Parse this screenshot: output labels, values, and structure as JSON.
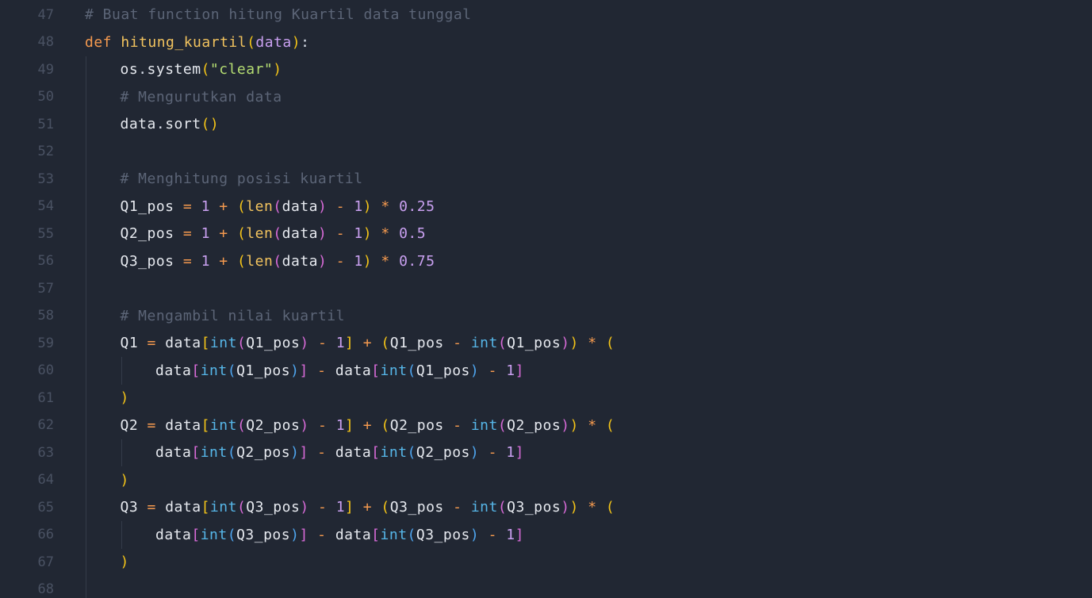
{
  "editor": {
    "language": "python",
    "theme": {
      "background": "#212733",
      "line_number": "#4a5263",
      "comment": "#5c6577",
      "keyword": "#f59a4f",
      "function": "#f2c35e",
      "string": "#b5dd72",
      "number": "#c9a0f0",
      "builtin": "#56b6e8",
      "bracket_level_1": "#f5c518",
      "bracket_level_2": "#d86bd8",
      "bracket_level_3": "#4fa6f0"
    },
    "lines": [
      {
        "num": "47",
        "indent": 0,
        "tokens": [
          [
            "cmt",
            "# Buat function hitung Kuartil data tunggal"
          ]
        ]
      },
      {
        "num": "48",
        "indent": 0,
        "tokens": [
          [
            "kw",
            "def"
          ],
          [
            "pln",
            " "
          ],
          [
            "fn",
            "hitung_kuartil"
          ],
          [
            "b1",
            "("
          ],
          [
            "par",
            "data"
          ],
          [
            "b1",
            ")"
          ],
          [
            "pln",
            ":"
          ]
        ]
      },
      {
        "num": "49",
        "indent": 1,
        "tokens": [
          [
            "var",
            "os"
          ],
          [
            "pln",
            "."
          ],
          [
            "var",
            "system"
          ],
          [
            "b1",
            "("
          ],
          [
            "str",
            "\"clear\""
          ],
          [
            "b1",
            ")"
          ]
        ]
      },
      {
        "num": "50",
        "indent": 1,
        "tokens": [
          [
            "cmt",
            "# Mengurutkan data"
          ]
        ]
      },
      {
        "num": "51",
        "indent": 1,
        "tokens": [
          [
            "var",
            "data"
          ],
          [
            "pln",
            "."
          ],
          [
            "var",
            "sort"
          ],
          [
            "b1",
            "()"
          ]
        ]
      },
      {
        "num": "52",
        "indent": 1,
        "tokens": []
      },
      {
        "num": "53",
        "indent": 1,
        "tokens": [
          [
            "cmt",
            "# Menghitung posisi kuartil"
          ]
        ]
      },
      {
        "num": "54",
        "indent": 1,
        "tokens": [
          [
            "var",
            "Q1_pos"
          ],
          [
            "pln",
            " "
          ],
          [
            "op",
            "="
          ],
          [
            "pln",
            " "
          ],
          [
            "num",
            "1"
          ],
          [
            "pln",
            " "
          ],
          [
            "op",
            "+"
          ],
          [
            "pln",
            " "
          ],
          [
            "b1",
            "("
          ],
          [
            "fn",
            "len"
          ],
          [
            "b2",
            "("
          ],
          [
            "var",
            "data"
          ],
          [
            "b2",
            ")"
          ],
          [
            "pln",
            " "
          ],
          [
            "op",
            "-"
          ],
          [
            "pln",
            " "
          ],
          [
            "num",
            "1"
          ],
          [
            "b1",
            ")"
          ],
          [
            "pln",
            " "
          ],
          [
            "op",
            "*"
          ],
          [
            "pln",
            " "
          ],
          [
            "num",
            "0.25"
          ]
        ]
      },
      {
        "num": "55",
        "indent": 1,
        "tokens": [
          [
            "var",
            "Q2_pos"
          ],
          [
            "pln",
            " "
          ],
          [
            "op",
            "="
          ],
          [
            "pln",
            " "
          ],
          [
            "num",
            "1"
          ],
          [
            "pln",
            " "
          ],
          [
            "op",
            "+"
          ],
          [
            "pln",
            " "
          ],
          [
            "b1",
            "("
          ],
          [
            "fn",
            "len"
          ],
          [
            "b2",
            "("
          ],
          [
            "var",
            "data"
          ],
          [
            "b2",
            ")"
          ],
          [
            "pln",
            " "
          ],
          [
            "op",
            "-"
          ],
          [
            "pln",
            " "
          ],
          [
            "num",
            "1"
          ],
          [
            "b1",
            ")"
          ],
          [
            "pln",
            " "
          ],
          [
            "op",
            "*"
          ],
          [
            "pln",
            " "
          ],
          [
            "num",
            "0.5"
          ]
        ]
      },
      {
        "num": "56",
        "indent": 1,
        "tokens": [
          [
            "var",
            "Q3_pos"
          ],
          [
            "pln",
            " "
          ],
          [
            "op",
            "="
          ],
          [
            "pln",
            " "
          ],
          [
            "num",
            "1"
          ],
          [
            "pln",
            " "
          ],
          [
            "op",
            "+"
          ],
          [
            "pln",
            " "
          ],
          [
            "b1",
            "("
          ],
          [
            "fn",
            "len"
          ],
          [
            "b2",
            "("
          ],
          [
            "var",
            "data"
          ],
          [
            "b2",
            ")"
          ],
          [
            "pln",
            " "
          ],
          [
            "op",
            "-"
          ],
          [
            "pln",
            " "
          ],
          [
            "num",
            "1"
          ],
          [
            "b1",
            ")"
          ],
          [
            "pln",
            " "
          ],
          [
            "op",
            "*"
          ],
          [
            "pln",
            " "
          ],
          [
            "num",
            "0.75"
          ]
        ]
      },
      {
        "num": "57",
        "indent": 1,
        "tokens": []
      },
      {
        "num": "58",
        "indent": 1,
        "tokens": [
          [
            "cmt",
            "# Mengambil nilai kuartil"
          ]
        ]
      },
      {
        "num": "59",
        "indent": 1,
        "tokens": [
          [
            "var",
            "Q1"
          ],
          [
            "pln",
            " "
          ],
          [
            "op",
            "="
          ],
          [
            "pln",
            " "
          ],
          [
            "var",
            "data"
          ],
          [
            "b1",
            "["
          ],
          [
            "bi",
            "int"
          ],
          [
            "b2",
            "("
          ],
          [
            "var",
            "Q1_pos"
          ],
          [
            "b2",
            ")"
          ],
          [
            "pln",
            " "
          ],
          [
            "op",
            "-"
          ],
          [
            "pln",
            " "
          ],
          [
            "num",
            "1"
          ],
          [
            "b1",
            "]"
          ],
          [
            "pln",
            " "
          ],
          [
            "op",
            "+"
          ],
          [
            "pln",
            " "
          ],
          [
            "b1",
            "("
          ],
          [
            "var",
            "Q1_pos"
          ],
          [
            "pln",
            " "
          ],
          [
            "op",
            "-"
          ],
          [
            "pln",
            " "
          ],
          [
            "bi",
            "int"
          ],
          [
            "b2",
            "("
          ],
          [
            "var",
            "Q1_pos"
          ],
          [
            "b2",
            ")"
          ],
          [
            "b1",
            ")"
          ],
          [
            "pln",
            " "
          ],
          [
            "op",
            "*"
          ],
          [
            "pln",
            " "
          ],
          [
            "b1",
            "("
          ]
        ]
      },
      {
        "num": "60",
        "indent": 2,
        "tokens": [
          [
            "var",
            "data"
          ],
          [
            "b2",
            "["
          ],
          [
            "bi",
            "int"
          ],
          [
            "b3",
            "("
          ],
          [
            "var",
            "Q1_pos"
          ],
          [
            "b3",
            ")"
          ],
          [
            "b2",
            "]"
          ],
          [
            "pln",
            " "
          ],
          [
            "op",
            "-"
          ],
          [
            "pln",
            " "
          ],
          [
            "var",
            "data"
          ],
          [
            "b2",
            "["
          ],
          [
            "bi",
            "int"
          ],
          [
            "b3",
            "("
          ],
          [
            "var",
            "Q1_pos"
          ],
          [
            "b3",
            ")"
          ],
          [
            "pln",
            " "
          ],
          [
            "op",
            "-"
          ],
          [
            "pln",
            " "
          ],
          [
            "num",
            "1"
          ],
          [
            "b2",
            "]"
          ]
        ]
      },
      {
        "num": "61",
        "indent": 1,
        "tokens": [
          [
            "b1",
            ")"
          ]
        ]
      },
      {
        "num": "62",
        "indent": 1,
        "tokens": [
          [
            "var",
            "Q2"
          ],
          [
            "pln",
            " "
          ],
          [
            "op",
            "="
          ],
          [
            "pln",
            " "
          ],
          [
            "var",
            "data"
          ],
          [
            "b1",
            "["
          ],
          [
            "bi",
            "int"
          ],
          [
            "b2",
            "("
          ],
          [
            "var",
            "Q2_pos"
          ],
          [
            "b2",
            ")"
          ],
          [
            "pln",
            " "
          ],
          [
            "op",
            "-"
          ],
          [
            "pln",
            " "
          ],
          [
            "num",
            "1"
          ],
          [
            "b1",
            "]"
          ],
          [
            "pln",
            " "
          ],
          [
            "op",
            "+"
          ],
          [
            "pln",
            " "
          ],
          [
            "b1",
            "("
          ],
          [
            "var",
            "Q2_pos"
          ],
          [
            "pln",
            " "
          ],
          [
            "op",
            "-"
          ],
          [
            "pln",
            " "
          ],
          [
            "bi",
            "int"
          ],
          [
            "b2",
            "("
          ],
          [
            "var",
            "Q2_pos"
          ],
          [
            "b2",
            ")"
          ],
          [
            "b1",
            ")"
          ],
          [
            "pln",
            " "
          ],
          [
            "op",
            "*"
          ],
          [
            "pln",
            " "
          ],
          [
            "b1",
            "("
          ]
        ]
      },
      {
        "num": "63",
        "indent": 2,
        "tokens": [
          [
            "var",
            "data"
          ],
          [
            "b2",
            "["
          ],
          [
            "bi",
            "int"
          ],
          [
            "b3",
            "("
          ],
          [
            "var",
            "Q2_pos"
          ],
          [
            "b3",
            ")"
          ],
          [
            "b2",
            "]"
          ],
          [
            "pln",
            " "
          ],
          [
            "op",
            "-"
          ],
          [
            "pln",
            " "
          ],
          [
            "var",
            "data"
          ],
          [
            "b2",
            "["
          ],
          [
            "bi",
            "int"
          ],
          [
            "b3",
            "("
          ],
          [
            "var",
            "Q2_pos"
          ],
          [
            "b3",
            ")"
          ],
          [
            "pln",
            " "
          ],
          [
            "op",
            "-"
          ],
          [
            "pln",
            " "
          ],
          [
            "num",
            "1"
          ],
          [
            "b2",
            "]"
          ]
        ]
      },
      {
        "num": "64",
        "indent": 1,
        "tokens": [
          [
            "b1",
            ")"
          ]
        ]
      },
      {
        "num": "65",
        "indent": 1,
        "tokens": [
          [
            "var",
            "Q3"
          ],
          [
            "pln",
            " "
          ],
          [
            "op",
            "="
          ],
          [
            "pln",
            " "
          ],
          [
            "var",
            "data"
          ],
          [
            "b1",
            "["
          ],
          [
            "bi",
            "int"
          ],
          [
            "b2",
            "("
          ],
          [
            "var",
            "Q3_pos"
          ],
          [
            "b2",
            ")"
          ],
          [
            "pln",
            " "
          ],
          [
            "op",
            "-"
          ],
          [
            "pln",
            " "
          ],
          [
            "num",
            "1"
          ],
          [
            "b1",
            "]"
          ],
          [
            "pln",
            " "
          ],
          [
            "op",
            "+"
          ],
          [
            "pln",
            " "
          ],
          [
            "b1",
            "("
          ],
          [
            "var",
            "Q3_pos"
          ],
          [
            "pln",
            " "
          ],
          [
            "op",
            "-"
          ],
          [
            "pln",
            " "
          ],
          [
            "bi",
            "int"
          ],
          [
            "b2",
            "("
          ],
          [
            "var",
            "Q3_pos"
          ],
          [
            "b2",
            ")"
          ],
          [
            "b1",
            ")"
          ],
          [
            "pln",
            " "
          ],
          [
            "op",
            "*"
          ],
          [
            "pln",
            " "
          ],
          [
            "b1",
            "("
          ]
        ]
      },
      {
        "num": "66",
        "indent": 2,
        "tokens": [
          [
            "var",
            "data"
          ],
          [
            "b2",
            "["
          ],
          [
            "bi",
            "int"
          ],
          [
            "b3",
            "("
          ],
          [
            "var",
            "Q3_pos"
          ],
          [
            "b3",
            ")"
          ],
          [
            "b2",
            "]"
          ],
          [
            "pln",
            " "
          ],
          [
            "op",
            "-"
          ],
          [
            "pln",
            " "
          ],
          [
            "var",
            "data"
          ],
          [
            "b2",
            "["
          ],
          [
            "bi",
            "int"
          ],
          [
            "b3",
            "("
          ],
          [
            "var",
            "Q3_pos"
          ],
          [
            "b3",
            ")"
          ],
          [
            "pln",
            " "
          ],
          [
            "op",
            "-"
          ],
          [
            "pln",
            " "
          ],
          [
            "num",
            "1"
          ],
          [
            "b2",
            "]"
          ]
        ]
      },
      {
        "num": "67",
        "indent": 1,
        "tokens": [
          [
            "b1",
            ")"
          ]
        ]
      },
      {
        "num": "68",
        "indent": 1,
        "tokens": []
      }
    ]
  }
}
